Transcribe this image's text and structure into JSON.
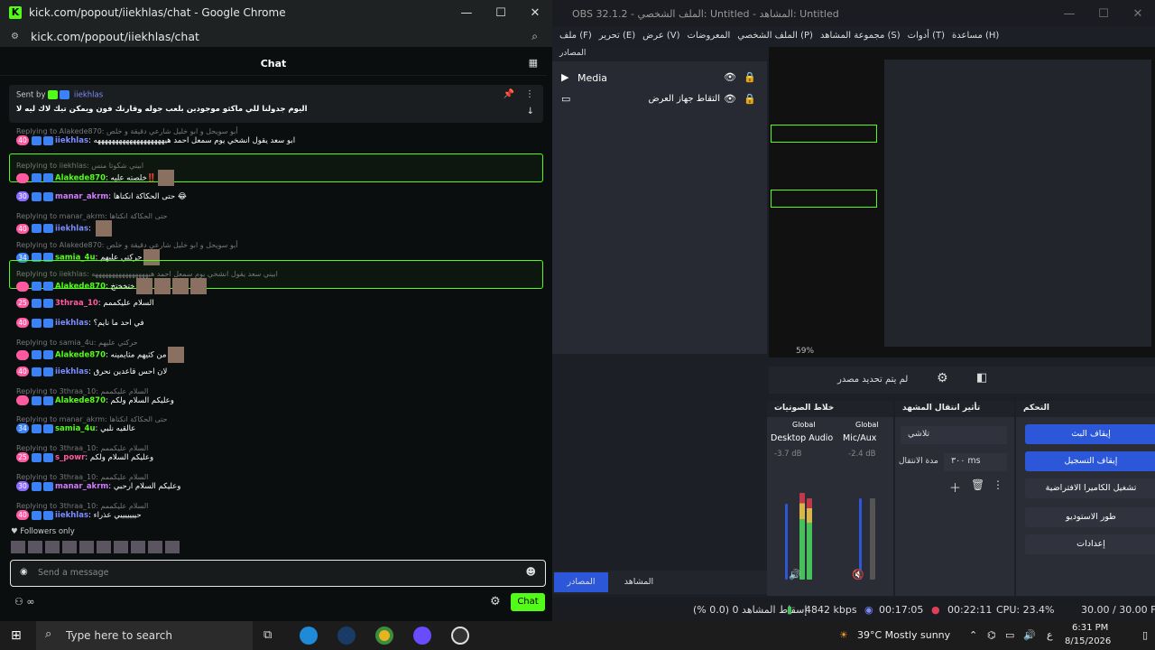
{
  "chrome": {
    "title": "kick.com/popout/iiekhlas/chat - Google Chrome",
    "url": "kick.com/popout/iiekhlas/chat",
    "header": "Chat",
    "pinned_sender_prefix": "Sent by",
    "pinned_sender": "iiekhlas",
    "pinned_message": "اليوم جدولنا للي ماكثو موجودين بلعب جوله وقارنك فون ويمكن تيك لاك ليه لا",
    "messages": [
      {
        "num": "40",
        "color": "#ff5aa0",
        "user": "iiekhlas",
        "ucolor": "#7b8cff",
        "msg": "ابو سعد يقول انشخي يوم سمعل احمد هيهههههههههههههههههههه",
        "reply": "Replying to Alakede870: أبو سويحل و ابو خليل شارعي دقيقة و خلص"
      },
      {
        "num": "",
        "color": "#ff5aa0",
        "user": "Alakede870",
        "ucolor": "#53fc18",
        "msg": "خلصته عليه‼️",
        "reply": "Replying to iiekhlas: ابيني شكوتا منس"
      },
      {
        "num": "30",
        "color": "#8a6cff",
        "user": "manar_akrm",
        "ucolor": "#d17bff",
        "msg": "حتى الحكاكة انكتاها 😂",
        "reply": ""
      },
      {
        "num": "40",
        "color": "#ff5aa0",
        "user": "iiekhlas",
        "ucolor": "#7b8cff",
        "msg": "",
        "reply": "Replying to manar_akrm: حتى الحكاكة انكتاها"
      },
      {
        "num": "34",
        "color": "#3b82f6",
        "user": "samia_4u",
        "ucolor": "#53fc18",
        "msg": "حركتي عليهم",
        "reply": "Replying to Alakede870: أبو سويحل و ابو خليل شارعي دقيقة و خلص"
      },
      {
        "num": "",
        "color": "#ff5aa0",
        "user": "Alakede870",
        "ucolor": "#53fc18",
        "msg": "ختخختخ",
        "reply": "Replying to iiekhlas: ابيني سعد يقول انشخي يوم سمعل احمد هيههههههههههههههههه"
      },
      {
        "num": "25",
        "color": "#ff5aa0",
        "user": "3thraa_10",
        "ucolor": "#ff5aa0",
        "msg": "السلام عليكممم",
        "reply": ""
      },
      {
        "num": "40",
        "color": "#ff5aa0",
        "user": "iiekhlas",
        "ucolor": "#7b8cff",
        "msg": "في احد ما نايم؟",
        "reply": ""
      },
      {
        "num": "",
        "color": "#ff5aa0",
        "user": "Alakede870",
        "ucolor": "#53fc18",
        "msg": "من كثيهم مثايمينه",
        "reply": "Replying to samia_4u: حركتي عليهم"
      },
      {
        "num": "40",
        "color": "#ff5aa0",
        "user": "iiekhlas",
        "ucolor": "#7b8cff",
        "msg": "لان احس قاعدين نحرق",
        "reply": ""
      },
      {
        "num": "",
        "color": "#ff5aa0",
        "user": "Alakede870",
        "ucolor": "#53fc18",
        "msg": "وعليكم السلام ولكم",
        "reply": "Replying to 3thraa_10: السلام عليكممم"
      },
      {
        "num": "34",
        "color": "#3b82f6",
        "user": "samia_4u",
        "ucolor": "#53fc18",
        "msg": "عالقيه نلبي",
        "reply": "Replying to manar_akrm: حتى الحكاكة انكتاها"
      },
      {
        "num": "25",
        "color": "#ff5aa0",
        "user": "s_powr",
        "ucolor": "#ff5aa0",
        "msg": "وعليكم السلام ولكم",
        "reply": "Replying to 3thraa_10: السلام عليكممم"
      },
      {
        "num": "30",
        "color": "#8a6cff",
        "user": "manar_akrm",
        "ucolor": "#d17bff",
        "msg": "وعليكم السلام ارحبي",
        "reply": "Replying to 3thraa_10: السلام عليكممم"
      },
      {
        "num": "40",
        "color": "#ff5aa0",
        "user": "iiekhlas",
        "ucolor": "#7b8cff",
        "msg": "حيييييييي عذراء",
        "reply": "Replying to 3thraa_10: السلام عليكممم"
      }
    ],
    "followers_only": "Followers only",
    "input_placeholder": "Send a message",
    "chat_button": "Chat"
  },
  "obs": {
    "title": "OBS 32.1.2 - الملف الشخصي: Untitled - المشاهد: Untitled",
    "menu": [
      "ملف (F)",
      "تحرير (E)",
      "عرض (V)",
      "المعروضات",
      "الملف الشخصي (P)",
      "مجموعة المشاهد (S)",
      "أدوات (T)",
      "مساعدة (H)"
    ],
    "sources_header": "المصادر",
    "sources": [
      {
        "label": "Media",
        "icon": "play-icon"
      },
      {
        "label": "التقاط جهاز العرض",
        "icon": "monitor-icon"
      }
    ],
    "zoom": "59%",
    "no_source": "لم يتم تحديد مصدر",
    "mixer_title": "خلاط الصوتيات",
    "transition_title": "تأثير انتقال المشهد",
    "controls_title": "التحكم",
    "mixer": [
      {
        "scope": "Global",
        "name": "Desktop Audio",
        "db": "-3.7 dB"
      },
      {
        "scope": "Global",
        "name": "Mic/Aux",
        "db": "-2.4 dB"
      }
    ],
    "meter_scale": [
      "0",
      "-6",
      "-12",
      "-18",
      "-24",
      "-30",
      "-36",
      "-42",
      "-48",
      "-54",
      "-60"
    ],
    "transition_type": "تلاشي",
    "duration_label": "مدة الانتقال",
    "duration_value": "٣٠٠ ms",
    "controls": [
      "إيقاف البث",
      "إيقاف التسجيل",
      "تشغيل الكاميرا الافتراضية",
      "طور الاستوديو",
      "إعدادات"
    ],
    "bottom_tabs": [
      "المصادر",
      "المشاهد"
    ],
    "status": {
      "dropped": "إسقاط المشاهد 0 (0.0 %)",
      "kbps": "4842 kbps",
      "stream_time": "00:17:05",
      "rec_time": "00:22:11",
      "cpu": "CPU: 23.4%",
      "fps": "30.00 / 30.00 FPS"
    }
  },
  "taskbar": {
    "search": "Type here to search",
    "weather": "39°C  Mostly sunny",
    "lang": "ع",
    "time": "6:31 PM",
    "date": "8/15/2026"
  },
  "colors": {
    "kick_green": "#53fc18",
    "obs_blue": "#2b57d8"
  }
}
